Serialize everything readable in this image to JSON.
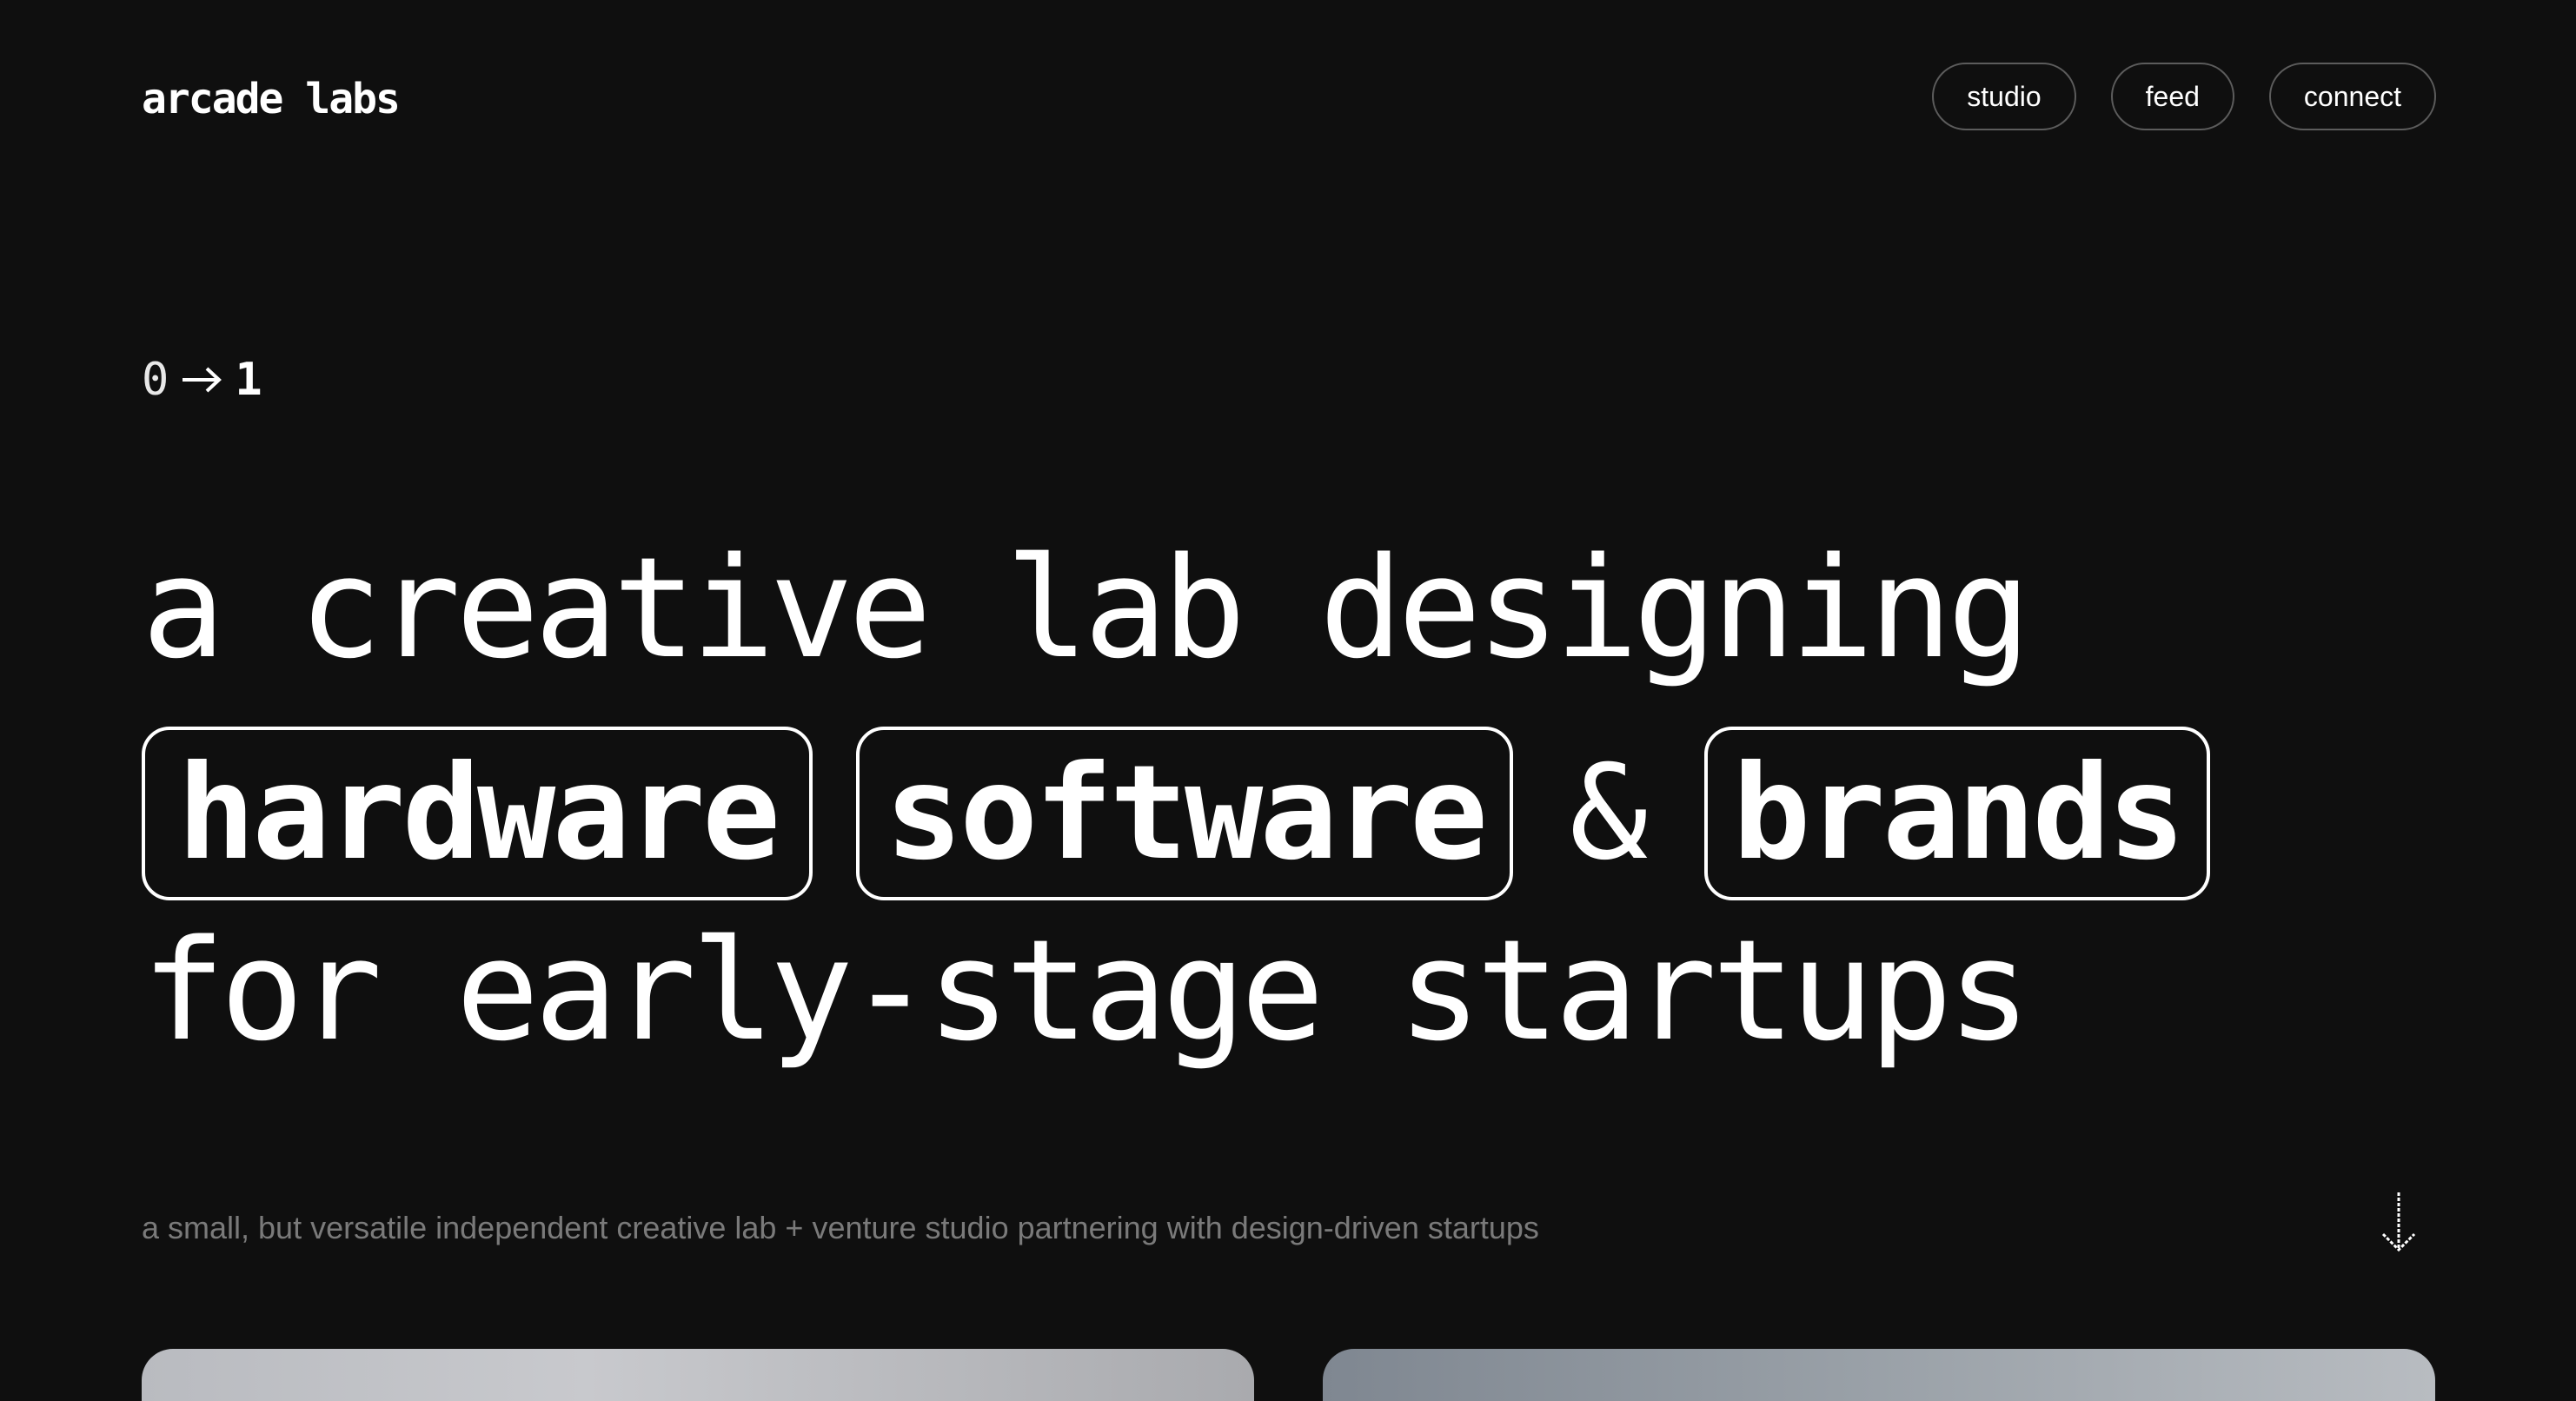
{
  "header": {
    "logo": "arcade labs",
    "nav": [
      {
        "label": "studio"
      },
      {
        "label": "feed"
      },
      {
        "label": "connect"
      }
    ]
  },
  "hero": {
    "counter_from": "0",
    "counter_to": "1",
    "line1": "a creative lab designing",
    "chips": [
      "hardware",
      "software",
      "brands"
    ],
    "ampersand": "&",
    "line3": "for early-stage startups",
    "tagline": "a small, but versatile independent creative lab + venture studio partnering with design-driven startups"
  },
  "icons": {
    "counter_arrow": "arrow-right-icon",
    "scroll": "arrow-down-icon"
  },
  "colors": {
    "background": "#0f0f0f",
    "text": "#ffffff",
    "muted": "#7a7a7a",
    "pill_border": "#5c5c5c"
  }
}
